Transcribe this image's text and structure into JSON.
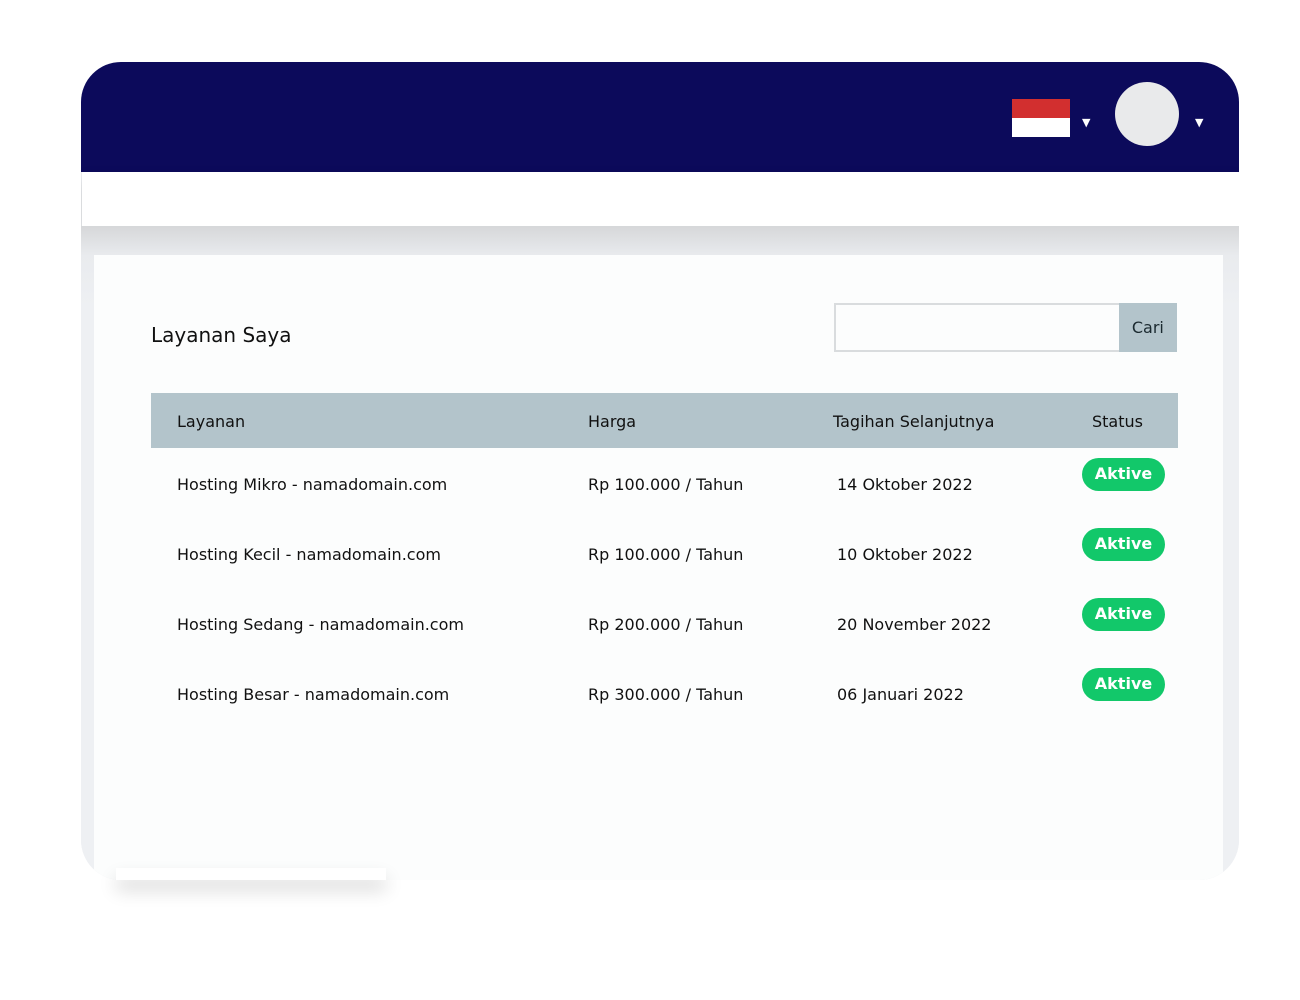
{
  "header": {
    "language_flag": "indonesia-flag",
    "colors": {
      "top_bar": "#0c0a5b",
      "flag_red": "#d22f2f",
      "flag_white": "#ffffff"
    }
  },
  "main": {
    "title": "Layanan Saya",
    "search": {
      "placeholder": "",
      "value": "",
      "button_label": "Cari"
    },
    "table": {
      "columns": [
        "Layanan",
        "Harga",
        "Tagihan Selanjutnya",
        "Status"
      ],
      "rows": [
        {
          "service": "Hosting Mikro - namadomain.com",
          "price": "Rp 100.000 / Tahun",
          "next_bill": "14 Oktober 2022",
          "status": "Aktive"
        },
        {
          "service": "Hosting Kecil - namadomain.com",
          "price": "Rp 100.000 / Tahun",
          "next_bill": "10 Oktober 2022",
          "status": "Aktive"
        },
        {
          "service": "Hosting Sedang - namadomain.com",
          "price": "Rp 200.000 / Tahun",
          "next_bill": "20 November 2022",
          "status": "Aktive"
        },
        {
          "service": "Hosting Besar - namadomain.com",
          "price": "Rp 300.000 / Tahun",
          "next_bill": "06 Januari 2022",
          "status": "Aktive"
        }
      ],
      "colors": {
        "header_bg": "#b3c4cb",
        "status_active": "#12c86a"
      }
    }
  }
}
